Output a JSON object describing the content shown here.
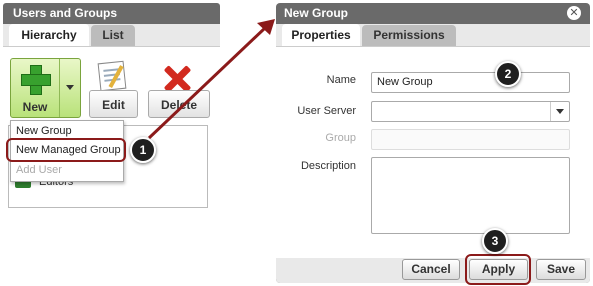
{
  "left_panel": {
    "title": "Users and Groups",
    "tabs": [
      "Hierarchy",
      "List"
    ],
    "toolbar": {
      "new_label": "New",
      "edit_label": "Edit",
      "delete_label": "Delete"
    },
    "dropdown": [
      "New Group",
      "New Managed Group",
      "Add User"
    ],
    "tree_item": "Editors"
  },
  "dialog": {
    "title": "New Group",
    "close": "✕",
    "tabs": [
      "Properties",
      "Permissions"
    ],
    "fields": {
      "name_label": "Name",
      "name_value": "New Group",
      "server_label": "User Server",
      "server_value": "",
      "group_label": "Group",
      "group_value": "",
      "description_label": "Description",
      "description_value": ""
    },
    "buttons": {
      "cancel": "Cancel",
      "apply": "Apply",
      "save": "Save"
    }
  },
  "callouts": [
    "1",
    "2",
    "3"
  ],
  "colors": {
    "highlight": "#8b1a1a",
    "panel_header": "#6a6a6a",
    "new_button_green": "#b9e27a"
  }
}
